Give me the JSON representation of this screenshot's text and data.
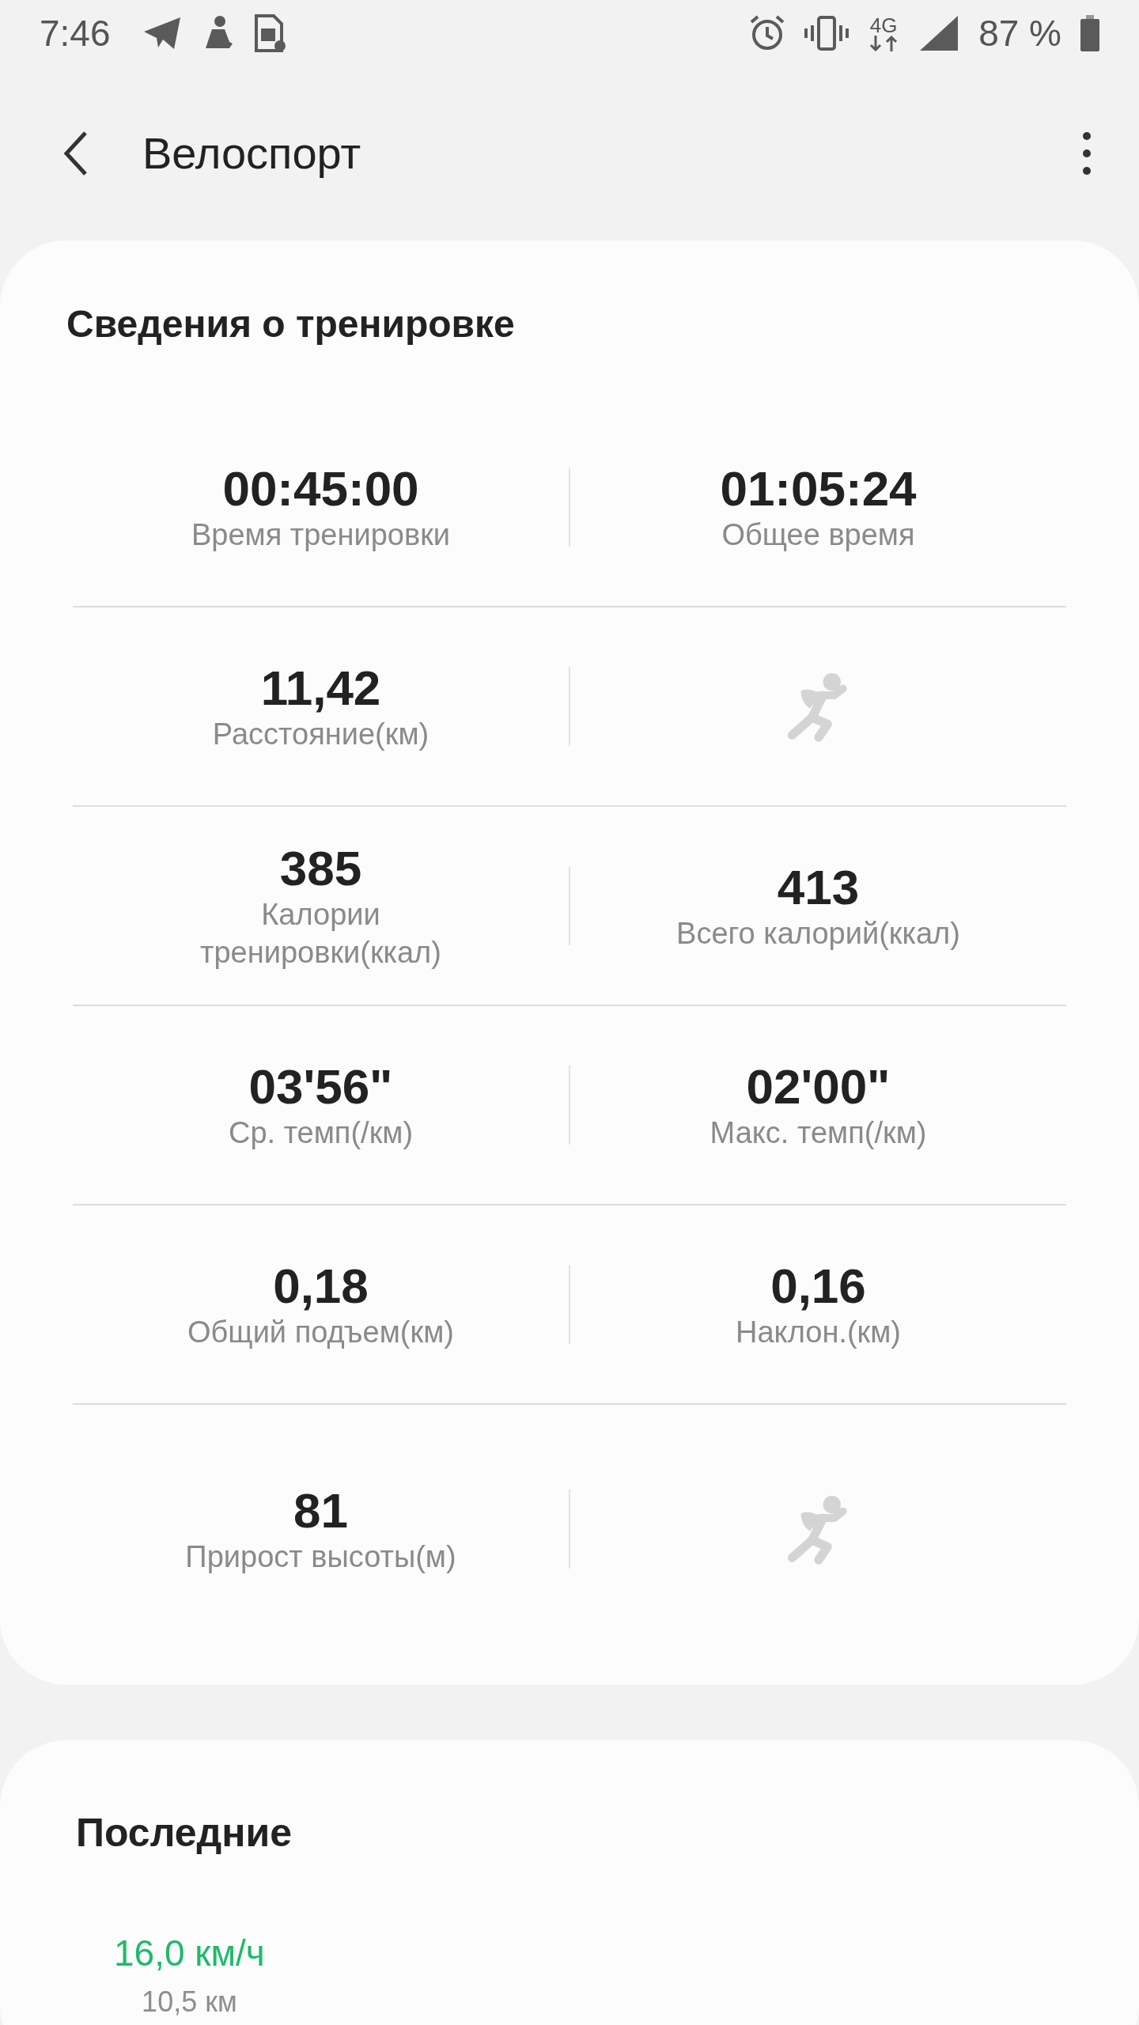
{
  "status_bar": {
    "time": "7:46",
    "network": "4G",
    "battery": "87 %"
  },
  "header": {
    "title": "Велоспорт"
  },
  "workout": {
    "title": "Сведения о тренировке",
    "rows": [
      [
        {
          "kind": "stat",
          "value": "00:45:00",
          "label": "Время тренировки"
        },
        {
          "kind": "stat",
          "value": "01:05:24",
          "label": "Общее время"
        }
      ],
      [
        {
          "kind": "stat",
          "value": "11,42",
          "label": "Расстояние(км)"
        },
        {
          "kind": "runner"
        }
      ],
      [
        {
          "kind": "stat",
          "value": "385",
          "label": "Калории тренировки(ккал)"
        },
        {
          "kind": "stat",
          "value": "413",
          "label": "Всего калорий(ккал)"
        }
      ],
      [
        {
          "kind": "stat",
          "value": "03'56\"",
          "label": "Ср. темп(/км)"
        },
        {
          "kind": "stat",
          "value": "02'00\"",
          "label": "Макс. темп(/км)"
        }
      ],
      [
        {
          "kind": "stat",
          "value": "0,18",
          "label": "Общий подъем(км)"
        },
        {
          "kind": "stat",
          "value": "0,16",
          "label": "Наклон.(км)"
        }
      ],
      [
        {
          "kind": "stat",
          "value": "81",
          "label": "Прирост высоты(м)"
        },
        {
          "kind": "runner"
        }
      ]
    ]
  },
  "recent": {
    "title": "Последние",
    "items": [
      {
        "speed": "16,0 км/ч",
        "distance": "10,5 км"
      }
    ]
  }
}
